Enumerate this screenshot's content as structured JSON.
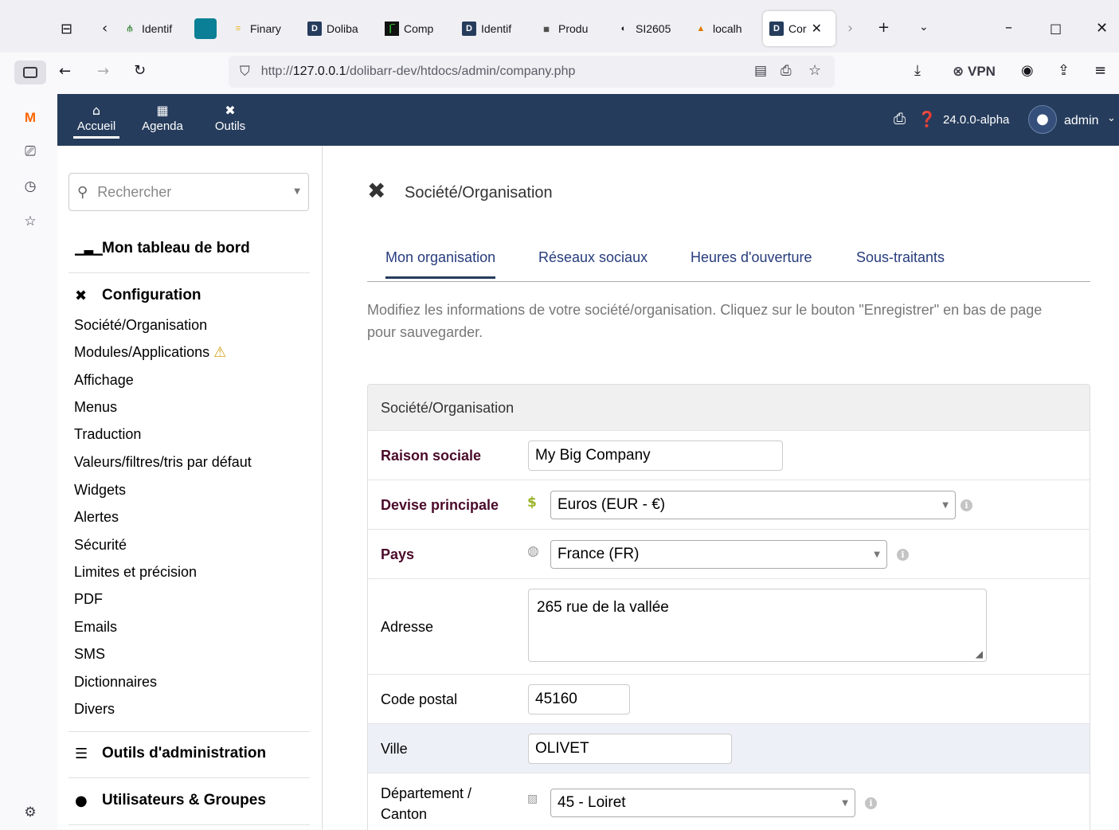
{
  "browser": {
    "tabs": [
      {
        "label": "Identif",
        "icon": "dolibarr-tree-icon"
      },
      {
        "label": "",
        "icon": "teal-app-icon"
      },
      {
        "label": "Finary",
        "icon": "finary-icon"
      },
      {
        "label": "Doliba",
        "icon": "dolibarr-d-icon"
      },
      {
        "label": "Comp",
        "icon": "terminal-green-icon"
      },
      {
        "label": "Identif",
        "icon": "dolibarr-d-icon"
      },
      {
        "label": "Produ",
        "icon": "prod-icon"
      },
      {
        "label": "SI2605",
        "icon": "puzzle-icon"
      },
      {
        "label": "localh",
        "icon": "phpmyadmin-icon"
      },
      {
        "label": "Cor",
        "icon": "dolibarr-d-icon"
      }
    ],
    "url_prefix": "http://",
    "url_host": "127.0.0.1",
    "url_path": "/dolibarr-dev/htdocs/admin/company.php",
    "vpn_label": "VPN"
  },
  "topbar": {
    "menus": [
      {
        "label": "Accueil",
        "icon": "home-icon"
      },
      {
        "label": "Agenda",
        "icon": "calendar-icon"
      },
      {
        "label": "Outils",
        "icon": "tools-icon"
      }
    ],
    "version": "24.0.0-alpha",
    "user": "admin"
  },
  "leftmenu": {
    "search_placeholder": "Rechercher",
    "dashboard": "Mon tableau de bord",
    "config_title": "Configuration",
    "config_items": [
      "Société/Organisation",
      "Modules/Applications",
      "Affichage",
      "Menus",
      "Traduction",
      "Valeurs/filtres/tris par défaut",
      "Widgets",
      "Alertes",
      "Sécurité",
      "Limites et précision",
      "PDF",
      "Emails",
      "SMS",
      "Dictionnaires",
      "Divers"
    ],
    "admin_tools": "Outils d'administration",
    "users_groups": "Utilisateurs & Groupes"
  },
  "main": {
    "page_title": "Société/Organisation",
    "tabs": [
      "Mon organisation",
      "Réseaux sociaux",
      "Heures d'ouverture",
      "Sous-traitants"
    ],
    "intro_line1": "Modifiez les informations de votre société/organisation. Cliquez sur le bouton \"Enregistrer\" en bas de page",
    "intro_line2": "pour sauvegarder.",
    "table_title": "Société/Organisation",
    "fields": {
      "name_label": "Raison sociale",
      "name_value": "My Big Company",
      "currency_label": "Devise principale",
      "currency_value": "Euros (EUR - €)",
      "country_label": "Pays",
      "country_value": "France (FR)",
      "address_label": "Adresse",
      "address_value": "265 rue de la vallée",
      "zip_label": "Code postal",
      "zip_value": "45160",
      "town_label": "Ville",
      "town_value": "OLIVET",
      "state_label_1": "Département /",
      "state_label_2": "Canton",
      "state_value": "45 - Loiret"
    }
  },
  "colors": {
    "topbar_bg": "#263c5c",
    "required_label": "#4a0a2a",
    "tab_link": "#263c7c",
    "warning": "#d4a017"
  }
}
